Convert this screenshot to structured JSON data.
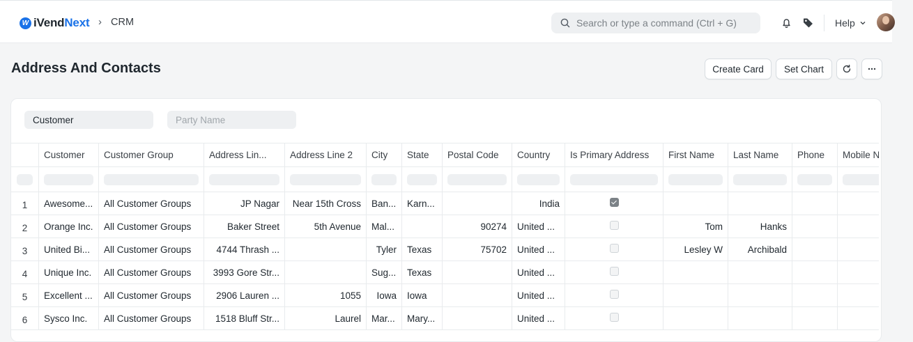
{
  "navbar": {
    "logo_prefix": "iVend",
    "logo_accent": "Next",
    "breadcrumb": "CRM",
    "search_placeholder": "Search or type a command (Ctrl + G)",
    "help_label": "Help"
  },
  "page": {
    "title": "Address And Contacts",
    "buttons": {
      "create_card": "Create Card",
      "set_chart": "Set Chart"
    }
  },
  "filters": {
    "customer": "Customer",
    "party_name_placeholder": "Party Name"
  },
  "table": {
    "columns": [
      "Customer",
      "Customer Group",
      "Address Lin...",
      "Address Line 2",
      "City",
      "State",
      "Postal Code",
      "Country",
      "Is Primary Address",
      "First Name",
      "Last Name",
      "Phone",
      "Mobile N"
    ],
    "rows": [
      {
        "num": "1",
        "customer": "Awesome...",
        "group": "All Customer Groups",
        "line1": "JP Nagar",
        "line2": "Near 15th Cross",
        "city": "Ban...",
        "state": "Karn...",
        "postal": "",
        "country": "India",
        "primary": true,
        "first": "",
        "last": "",
        "phone": "",
        "mobile": ""
      },
      {
        "num": "2",
        "customer": "Orange Inc.",
        "group": "All Customer Groups",
        "line1": "Baker Street",
        "line2": "5th Avenue",
        "city": "Mal...",
        "state": "",
        "postal": "90274",
        "country": "United ...",
        "primary": false,
        "first": "Tom",
        "last": "Hanks",
        "phone": "",
        "mobile": ""
      },
      {
        "num": "3",
        "customer": "United Bi...",
        "group": "All Customer Groups",
        "line1": "4744 Thrash ...",
        "line2": "",
        "city": "Tyler",
        "state": "Texas",
        "postal": "75702",
        "country": "United ...",
        "primary": false,
        "first": "Lesley W",
        "last": "Archibald",
        "phone": "",
        "mobile": ""
      },
      {
        "num": "4",
        "customer": "Unique Inc.",
        "group": "All Customer Groups",
        "line1": "3993 Gore Str...",
        "line2": "",
        "city": "Sug...",
        "state": "Texas",
        "postal": "",
        "country": "United ...",
        "primary": false,
        "first": "",
        "last": "",
        "phone": "",
        "mobile": ""
      },
      {
        "num": "5",
        "customer": "Excellent ...",
        "group": "All Customer Groups",
        "line1": "2906 Lauren ...",
        "line2": "1055",
        "city": "Iowa",
        "state": "Iowa",
        "postal": "",
        "country": "United ...",
        "primary": false,
        "first": "",
        "last": "",
        "phone": "",
        "mobile": ""
      },
      {
        "num": "6",
        "customer": "Sysco Inc.",
        "group": "All Customer Groups",
        "line1": "1518 Bluff Str...",
        "line2": "Laurel",
        "city": "Mar...",
        "state": "Mary...",
        "postal": "",
        "country": "United ...",
        "primary": false,
        "first": "",
        "last": "",
        "phone": "",
        "mobile": ""
      }
    ]
  }
}
